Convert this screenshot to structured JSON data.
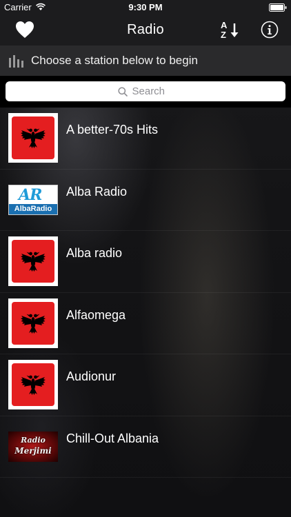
{
  "status_bar": {
    "carrier": "Carrier",
    "time": "9:30 PM"
  },
  "nav_bar": {
    "title": "Radio"
  },
  "prompt": {
    "text": "Choose a station below to begin"
  },
  "search": {
    "placeholder": "Search"
  },
  "stations": [
    {
      "name": "A better-70s Hits",
      "logo": "albanian-flag"
    },
    {
      "name": "Alba Radio",
      "logo": "albaradio-logo",
      "logo_text_big": "AR",
      "logo_text_small": "AlbaRadio"
    },
    {
      "name": "Alba radio",
      "logo": "albanian-flag"
    },
    {
      "name": "Alfaomega",
      "logo": "albanian-flag"
    },
    {
      "name": "Audionur",
      "logo": "albanian-flag"
    },
    {
      "name": "Chill-Out Albania",
      "logo": "radio-merjimi-logo",
      "logo_text_1": "Radio",
      "logo_text_2": "Merjimi"
    }
  ],
  "colors": {
    "flag_red": "#e41e20",
    "nav_bg": "#1c1c1e",
    "prompt_bg": "#2a2a2c"
  }
}
